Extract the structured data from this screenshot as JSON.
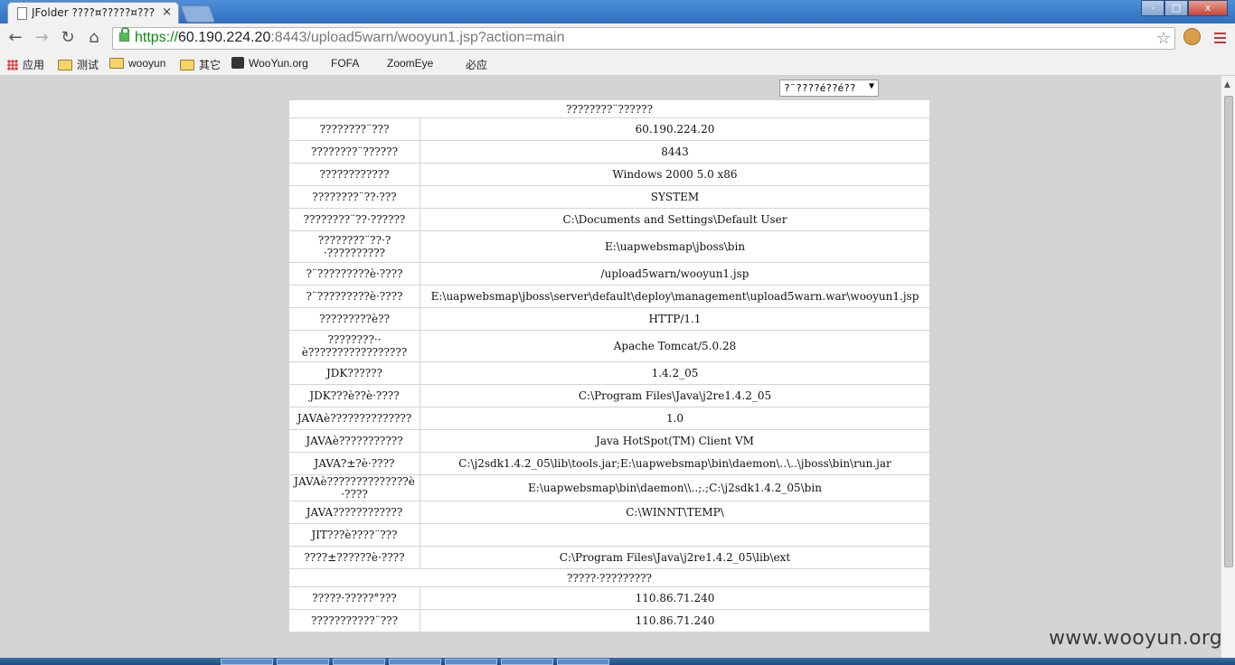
{
  "browser": {
    "tab_title": "JFolder ????¤?????¤???",
    "tab_close": "×",
    "url_scheme": "https://",
    "url_host": "60.190.224.20",
    "url_rest": ":8443/upload5warn/wooyun1.jsp?action=main",
    "window_buttons": [
      "-",
      "□",
      "x"
    ]
  },
  "bookmarks": [
    {
      "label": "应用",
      "icon": "apps-grid-icon"
    },
    {
      "label": "测试",
      "icon": "folder-icon"
    },
    {
      "label": "wooyun",
      "icon": "folder-icon"
    },
    {
      "label": "其它",
      "icon": "folder-icon"
    },
    {
      "label": "WooYun.org",
      "icon": "wooyun-favicon-icon"
    },
    {
      "label": "FOFA",
      "icon": "page-icon"
    },
    {
      "label": "ZoomEye",
      "icon": "page-icon"
    },
    {
      "label": "必应",
      "icon": "page-icon"
    }
  ],
  "language_select": {
    "value": "?¨????é??é??"
  },
  "server_info": {
    "header": "????????¨??????",
    "rows": [
      {
        "key": "????????¨???",
        "value": "60.190.224.20"
      },
      {
        "key": "????????¨??????",
        "value": "8443"
      },
      {
        "key": "????????????",
        "value": "Windows 2000 5.0 x86"
      },
      {
        "key": "????????¨??·???",
        "value": "SYSTEM"
      },
      {
        "key": "????????¨??·??????",
        "value": "C:\\Documents and Settings\\Default User"
      },
      {
        "key": "????????¨??·?·??????????",
        "value": "E:\\uapwebsmap\\jboss\\bin"
      },
      {
        "key": "?¨?????????è·????",
        "value": "/upload5warn/wooyun1.jsp"
      },
      {
        "key": "?¨?????????è·????",
        "value": "E:\\uapwebsmap\\jboss\\server\\default\\deploy\\management\\upload5warn.war\\wooyun1.jsp"
      },
      {
        "key": "?????????è??",
        "value": "HTTP/1.1"
      },
      {
        "key": "????????··è?????????????????",
        "value": "Apache Tomcat/5.0.28"
      },
      {
        "key": "JDK??????",
        "value": "1.4.2_05"
      },
      {
        "key": "JDK???è??è·????",
        "value": "C:\\Program Files\\Java\\j2re1.4.2_05"
      },
      {
        "key": "JAVAè??????????????",
        "value": "1.0"
      },
      {
        "key": "JAVAè???????????",
        "value": "Java HotSpot(TM) Client VM"
      },
      {
        "key": "JAVA?±?è·????",
        "value": "C:\\j2sdk1.4.2_05\\lib\\tools.jar;E:\\uapwebsmap\\bin\\daemon\\..\\..\\jboss\\bin\\run.jar"
      },
      {
        "key": "JAVAè??????????????è·????",
        "value": "E:\\uapwebsmap\\bin\\daemon\\\\..;.;C:\\j2sdk1.4.2_05\\bin"
      },
      {
        "key": "JAVA????????????",
        "value": "C:\\WINNT\\TEMP\\"
      },
      {
        "key": "JIT???è????¨???",
        "value": ""
      },
      {
        "key": "????±??????è·????",
        "value": "C:\\Program Files\\Java\\j2re1.4.2_05\\lib\\ext"
      }
    ],
    "client_header": "?????·?????????",
    "client_rows": [
      {
        "key": "?????·?????°???",
        "value": "110.86.71.240"
      },
      {
        "key": "???????????¨???",
        "value": "110.86.71.240"
      }
    ]
  },
  "watermark": "www.wooyun.org",
  "colors": {
    "page_bg": "#d4d4d4",
    "url_green": "#0b8a0b",
    "titlebar_blue": "#2f6fbf"
  }
}
